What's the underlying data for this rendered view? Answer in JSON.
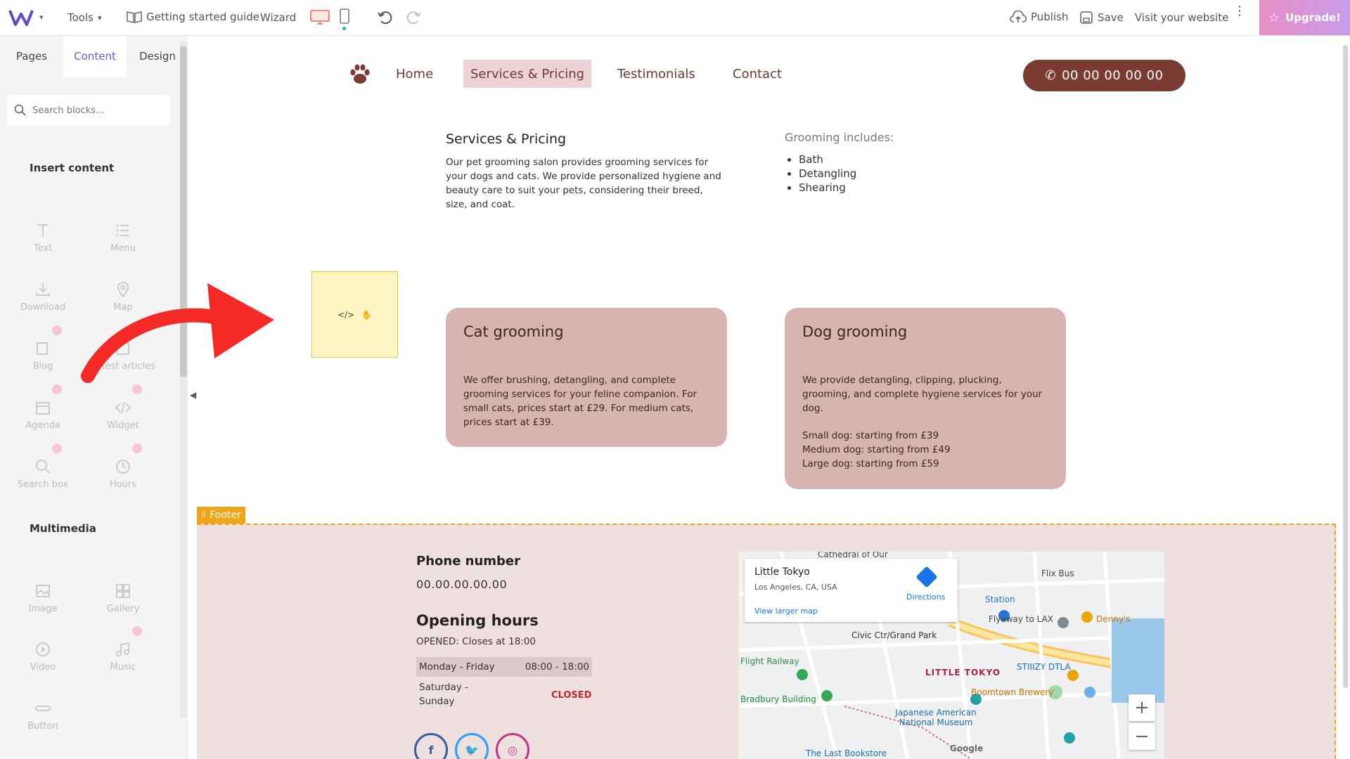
{
  "topbar": {
    "tools": "Tools",
    "guide": "Getting started guide",
    "wizard": "Wizard",
    "publish": "Publish",
    "save": "Save",
    "visit": "Visit your website",
    "upgrade": "Upgrade!"
  },
  "sidebar": {
    "tabs": [
      "Pages",
      "Content",
      "Design"
    ],
    "search_placeholder": "Search blocks...",
    "insert_title": "Insert content",
    "insert_blocks": [
      "Text",
      "Menu",
      "Download",
      "Map",
      "Blog",
      "Latest articles",
      "Agenda",
      "Widget",
      "Search box",
      "Hours"
    ],
    "multimedia_title": "Multimedia",
    "media_blocks": [
      "Image",
      "Gallery",
      "Video",
      "Music",
      "Button"
    ]
  },
  "site": {
    "nav": [
      "Home",
      "Services & Pricing",
      "Testimonials",
      "Contact"
    ],
    "phone_button": "00 00 00 00 00",
    "services_title": "Services & Pricing",
    "services_desc": "Our pet grooming salon provides grooming services for your dogs and cats. We provide personalized hygiene and beauty care to suit your pets, considering their breed, size, and coat.",
    "grooming_title": "Grooming includes:",
    "grooming_items": [
      "Bath",
      "Detangling",
      "Shearing"
    ],
    "cat_card": {
      "title": "Cat grooming",
      "desc": "We offer brushing, detangling, and complete grooming services for your feline companion. For small cats, prices start at £29. For medium cats, prices start at £39."
    },
    "dog_card": {
      "title": "Dog grooming",
      "desc": "We provide detangling, clipping, plucking, grooming, and complete hygiene services for your dog.",
      "prices": [
        "Small dog: starting from £39",
        "Medium dog: starting from £49",
        "Large dog: starting from £59"
      ]
    }
  },
  "footer": {
    "tag": "Footer",
    "phone_label": "Phone number",
    "phone": "00.00.00.00.00",
    "hours_title": "Opening hours",
    "open_status": "OPENED: Closes at 18:00",
    "row1_day": "Monday - Friday",
    "row1_time": "08:00 - 18:00",
    "row2_day": "Saturday - Sunday",
    "row2_status": "CLOSED"
  },
  "map": {
    "place": "Little Tokyo",
    "address": "Los Angeles, CA, USA",
    "larger": "View larger map",
    "directions": "Directions",
    "labels": [
      "Cathedral of Our",
      "Flix Bus",
      "Station",
      "Flyaway to LAX",
      "Denny's",
      "Civic Ctr/Grand Park",
      "Flight Railway",
      "LITTLE TOKYO",
      "STIIIZY DTLA",
      "Boomtown Brewery",
      "Bradbury Building",
      "Japanese American National Museum",
      "The Last Bookstore",
      "Google"
    ]
  },
  "colors": {
    "brand_brown": "#7a3b33",
    "card_bg": "#d7b3b1",
    "footer_bg": "#efe0e0",
    "accent_orange": "#f0a418",
    "active_tab": "#6b5ac6"
  }
}
